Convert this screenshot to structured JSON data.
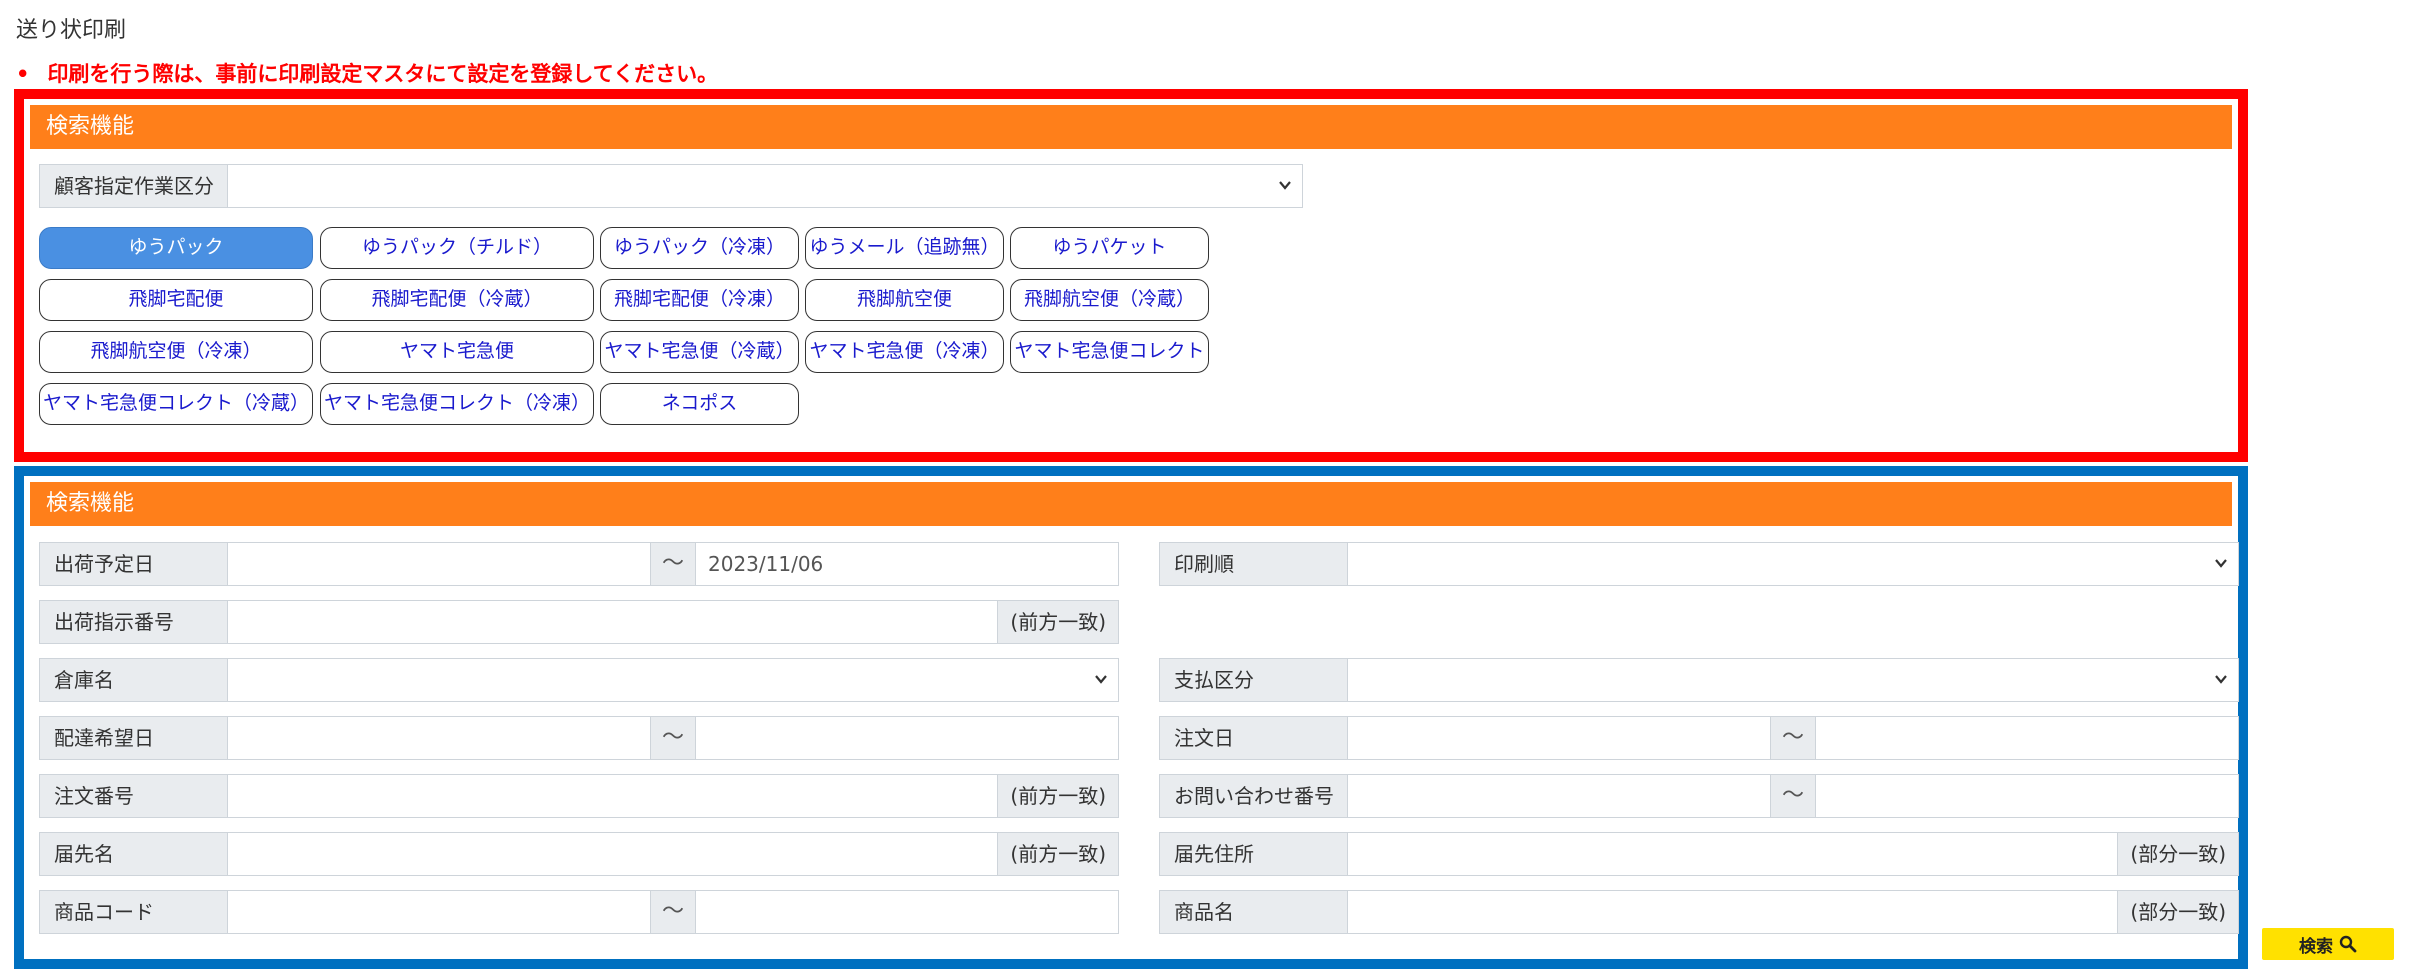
{
  "page": {
    "title": "送り状印刷"
  },
  "notice": {
    "bullet": "•",
    "text": "印刷を行う際は、事前に印刷設定マスタにて設定を登録してください。"
  },
  "carrier_section": {
    "header": "検索機能",
    "customer_work_label": "顧客指定作業区分",
    "customer_work_value": "",
    "buttons": [
      "ゆうパック",
      "ゆうパック（チルド）",
      "ゆうパック（冷凍）",
      "ゆうメール（追跡無）",
      "ゆうパケット",
      "飛脚宅配便",
      "飛脚宅配便（冷蔵）",
      "飛脚宅配便（冷凍）",
      "飛脚航空便",
      "飛脚航空便（冷蔵）",
      "飛脚航空便（冷凍）",
      "ヤマト宅急便",
      "ヤマト宅急便（冷蔵）",
      "ヤマト宅急便（冷凍）",
      "ヤマト宅急便コレクト",
      "ヤマト宅急便コレクト（冷蔵）",
      "ヤマト宅急便コレクト（冷凍）",
      "ネコポス"
    ],
    "active_button": "ゆうパック"
  },
  "search_section": {
    "header": "検索機能",
    "range_sep": "～",
    "ship_date": {
      "label": "出荷予定日",
      "from": "",
      "to": "2023/11/06"
    },
    "print_order": {
      "label": "印刷順",
      "value": ""
    },
    "ship_instruction_no": {
      "label": "出荷指示番号",
      "value": "",
      "suffix": "(前方一致)"
    },
    "warehouse": {
      "label": "倉庫名",
      "value": ""
    },
    "payment_type": {
      "label": "支払区分",
      "value": ""
    },
    "delivery_date": {
      "label": "配達希望日",
      "from": "",
      "to": ""
    },
    "order_date": {
      "label": "注文日",
      "from": "",
      "to": ""
    },
    "order_no": {
      "label": "注文番号",
      "value": "",
      "suffix": "(前方一致)"
    },
    "inquiry_no": {
      "label": "お問い合わせ番号",
      "from": "",
      "to": ""
    },
    "recipient_name": {
      "label": "届先名",
      "value": "",
      "suffix": "(前方一致)"
    },
    "recipient_address": {
      "label": "届先住所",
      "value": "",
      "suffix": "(部分一致)"
    },
    "product_code": {
      "label": "商品コード",
      "from": "",
      "to": ""
    },
    "product_name": {
      "label": "商品名",
      "value": "",
      "suffix": "(部分一致)"
    }
  },
  "search_button": {
    "label": "検索",
    "icon": "search-icon"
  }
}
